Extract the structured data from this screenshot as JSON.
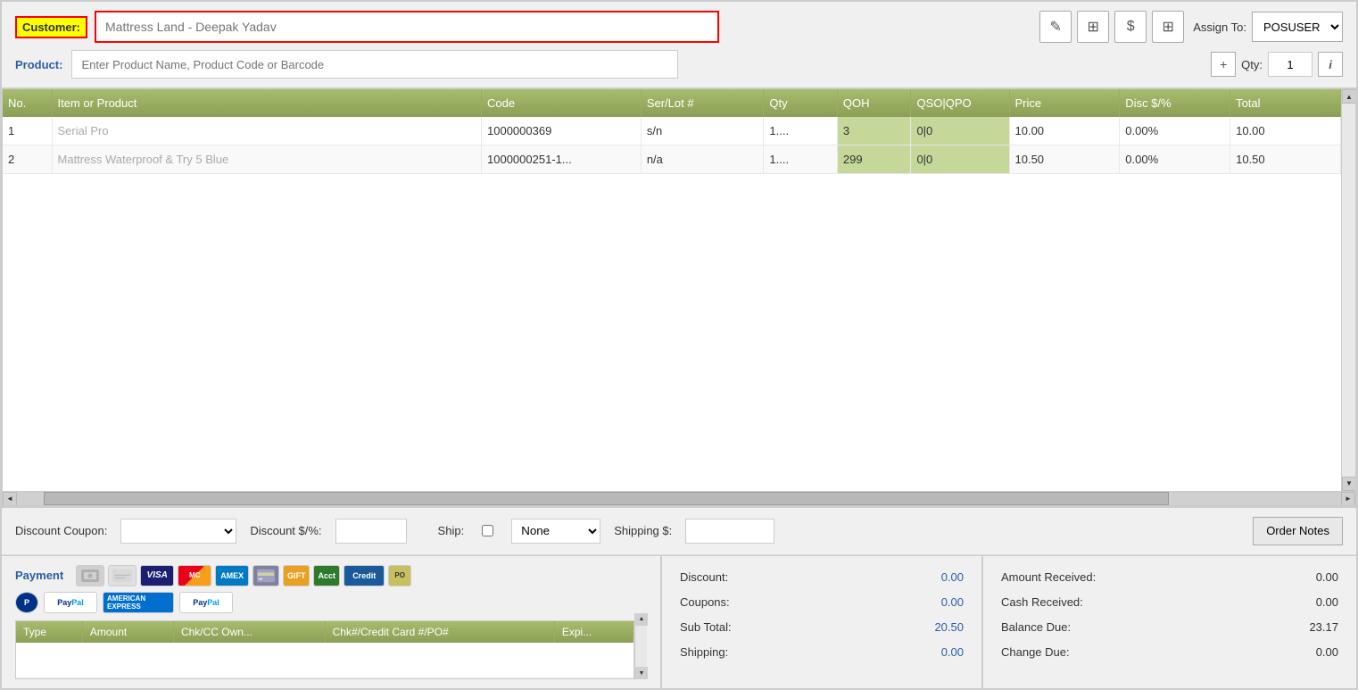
{
  "header": {
    "customer_label": "Customer:",
    "customer_placeholder": "Mattress Land - Deepak Yadav",
    "product_label": "Product:",
    "product_placeholder": "Enter Product Name, Product Code or Barcode",
    "assign_label": "Assign To:",
    "assign_value": "POSUSER",
    "qty_label": "Qty:",
    "qty_value": "1"
  },
  "toolbar": {
    "edit_icon": "✎",
    "add_icon": "⊞",
    "dollar_icon": "$",
    "grid_icon": "⊞",
    "info_icon": "i"
  },
  "table": {
    "columns": [
      "No.",
      "Item or Product",
      "Code",
      "Ser/Lot #",
      "Qty",
      "QOH",
      "QSO|QPO",
      "Price",
      "Disc $/%",
      "Total"
    ],
    "rows": [
      {
        "no": "1",
        "item": "Serial Pro",
        "code": "1000000369",
        "serlot": "s/n",
        "qty": "1....",
        "qoh": "3",
        "qso": "0|0",
        "price": "10.00",
        "disc": "0.00%",
        "total": "10.00"
      },
      {
        "no": "2",
        "item": "Mattress Waterproof & Try 5 Blue",
        "code": "1000000251-1...",
        "serlot": "n/a",
        "qty": "1....",
        "qoh": "299",
        "qso": "0|0",
        "price": "10.50",
        "disc": "0.00%",
        "total": "10.50"
      }
    ]
  },
  "discount_row": {
    "discount_coupon_label": "Discount Coupon:",
    "discount_pct_label": "Discount $/%:",
    "ship_label": "Ship:",
    "ship_option": "None",
    "shipping_label": "Shipping $:",
    "order_notes_label": "Order Notes"
  },
  "payment": {
    "label": "Payment",
    "icons": [
      "Cash",
      "Check",
      "VISA",
      "MC",
      "AMEX",
      "CC",
      "GIFT",
      "Acct",
      "Credit",
      "PO"
    ],
    "paypal_icons": [
      "P",
      "PayPal",
      "AMERICAN EXPRESS",
      "PayPal"
    ]
  },
  "payment_table": {
    "columns": [
      "Type",
      "Amount",
      "Chk/CC Own...",
      "Chk#/Credit Card #/PO#",
      "Expi..."
    ]
  },
  "totals": {
    "discount_label": "Discount:",
    "discount_value": "0.00",
    "coupons_label": "Coupons:",
    "coupons_value": "0.00",
    "subtotal_label": "Sub Total:",
    "subtotal_value": "20.50",
    "shipping_label": "Shipping:",
    "shipping_value": "0.00"
  },
  "right_totals": {
    "amount_received_label": "Amount Received:",
    "amount_received_value": "0.00",
    "cash_received_label": "Cash Received:",
    "cash_received_value": "0.00",
    "balance_due_label": "Balance Due:",
    "balance_due_value": "23.17",
    "change_due_label": "Change Due:",
    "change_due_value": "0.00"
  }
}
